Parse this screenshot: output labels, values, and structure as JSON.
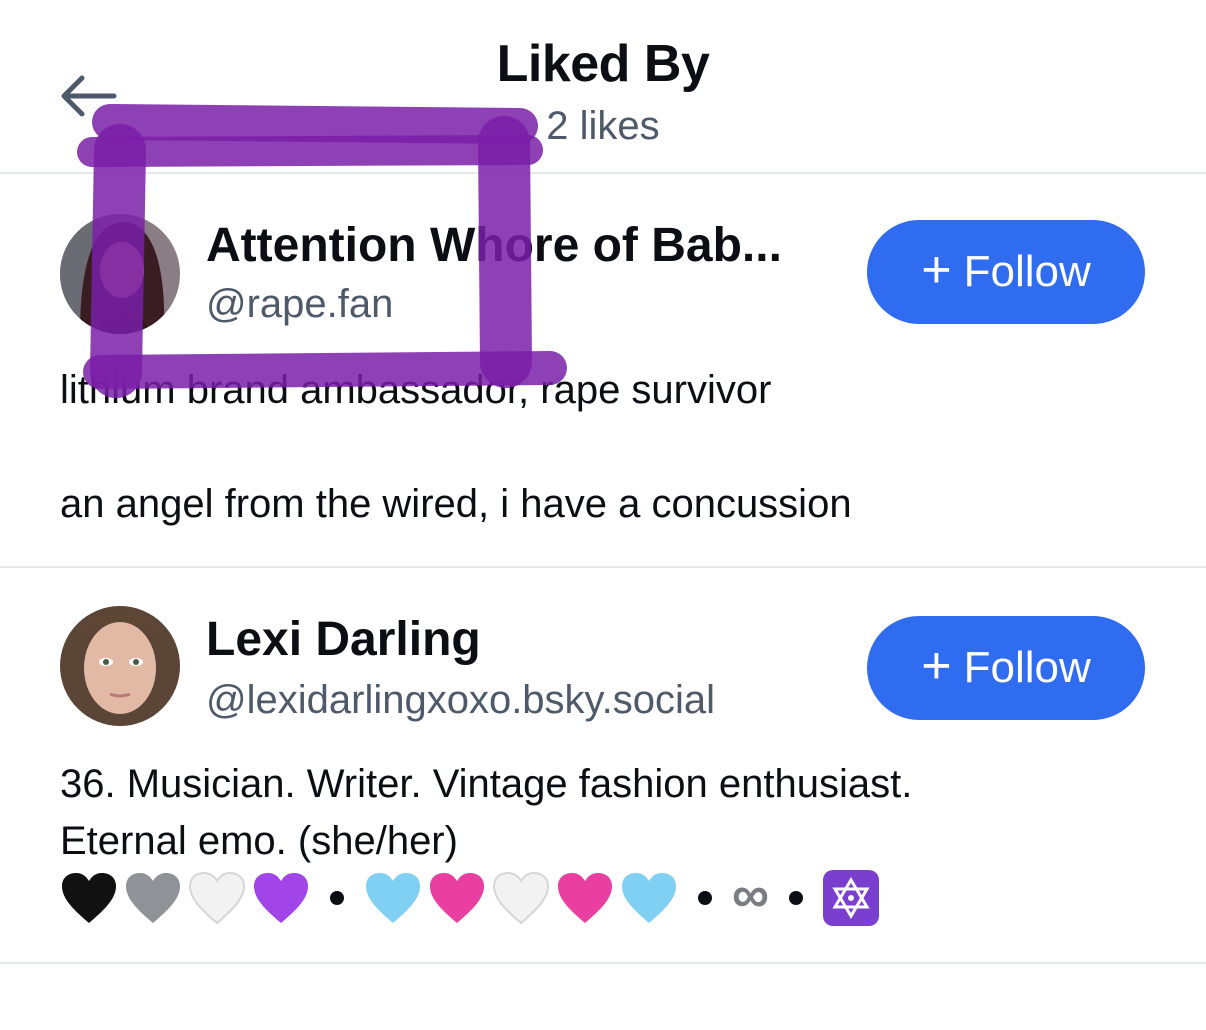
{
  "header": {
    "title": "Liked By",
    "subtitle": "2 likes",
    "back_icon": "arrow-left-icon"
  },
  "users": [
    {
      "name": "Attention Whore of Bab...",
      "handle": "@rape.fan",
      "follow_label": "Follow",
      "bio": "lithium brand ambassador, rape survivor\n\nan angel from the wired, i have a concussion"
    },
    {
      "name": "Lexi Darling",
      "handle": "@lexidarlingxoxo.bsky.social",
      "follow_label": "Follow",
      "bio": "36. Musician. Writer. Vintage fashion enthusiast.\nEternal emo. (she/her)",
      "emoji_line": [
        "black-heart",
        "grey-heart",
        "white-heart",
        "purple-heart",
        "bullet",
        "light-blue-heart",
        "pink-heart",
        "white-heart",
        "pink-heart",
        "light-blue-heart",
        "bullet",
        "infinity",
        "bullet",
        "star-of-david"
      ]
    }
  ],
  "colors": {
    "accent": "#2f6cf0",
    "text": "#0b0f14",
    "muted": "#4e5a6a",
    "divider": "#e6e9ee",
    "annotation": "#7a1fa8"
  }
}
